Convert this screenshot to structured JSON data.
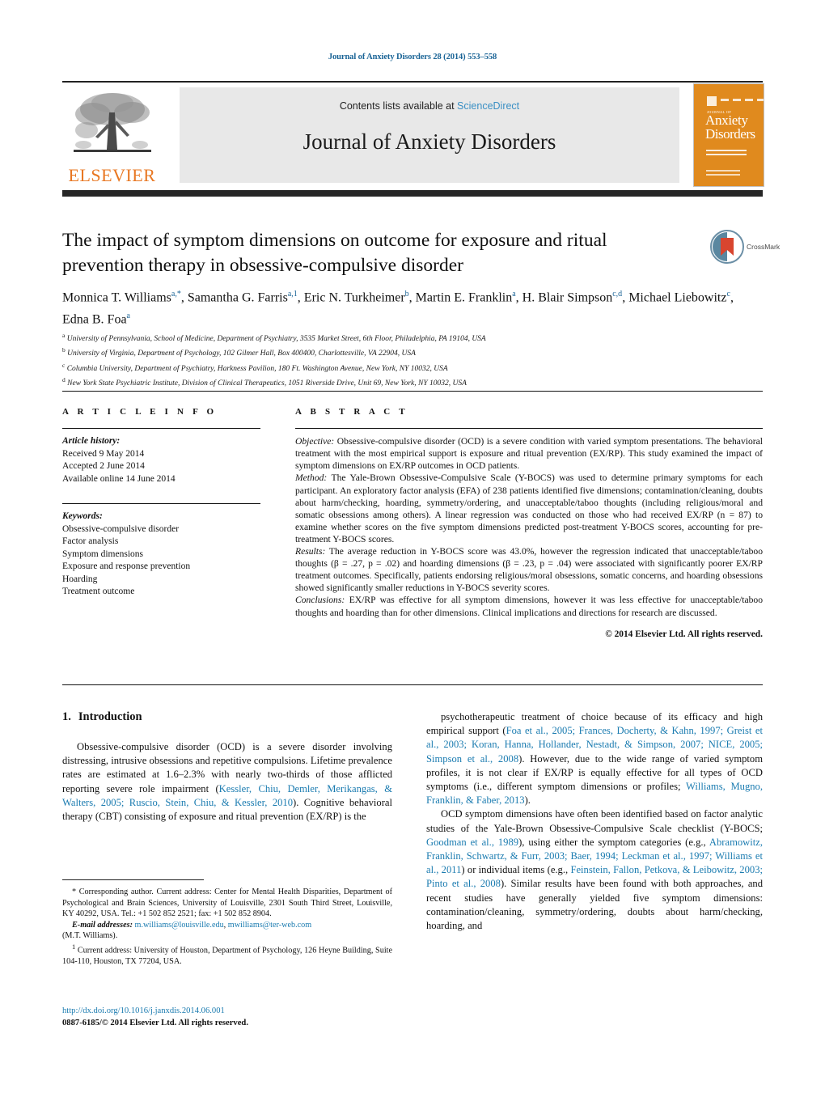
{
  "running_head": "Journal of Anxiety Disorders 28 (2014) 553–558",
  "masthead": {
    "contents_prefix": "Contents lists available at ",
    "sciencedirect": "ScienceDirect",
    "journal_title": "Journal of Anxiety Disorders",
    "publisher_logo_text": "ELSEVIER",
    "cover": {
      "journal_of": "JOURNAL OF",
      "line1": "Anxiety",
      "line2": "Disorders"
    }
  },
  "article": {
    "title": "The impact of symptom dimensions on outcome for exposure and ritual prevention therapy in obsessive-compulsive disorder",
    "crossmark_label": "CrossMark",
    "authors_html": "Monnica T. Williams<sup>a,<span class=\"plain\">*</span></sup>, Samantha G. Farris<sup>a,1</sup>, Eric N. Turkheimer<sup>b</sup>, Martin E. Franklin<sup>a</sup>, H. Blair Simpson<sup>c,d</sup>, Michael Liebowitz<sup>c</sup>, Edna B. Foa<sup>a</sup>",
    "affiliations": [
      {
        "mark": "a",
        "text": "University of Pennsylvania, School of Medicine, Department of Psychiatry, 3535 Market Street, 6th Floor, Philadelphia, PA 19104, USA"
      },
      {
        "mark": "b",
        "text": "University of Virginia, Department of Psychology, 102 Gilmer Hall, Box 400400, Charlottesville, VA 22904, USA"
      },
      {
        "mark": "c",
        "text": "Columbia University, Department of Psychiatry, Harkness Pavilion, 180 Ft. Washington Avenue, New York, NY 10032, USA"
      },
      {
        "mark": "d",
        "text": "New York State Psychiatric Institute, Division of Clinical Therapeutics, 1051 Riverside Drive, Unit 69, New York, NY 10032, USA"
      }
    ]
  },
  "article_info": {
    "heading": "A R T I C L E   I N F O",
    "history_label": "Article history:",
    "history": [
      "Received 9 May 2014",
      "Accepted 2 June 2014",
      "Available online 14 June 2014"
    ],
    "keywords_label": "Keywords:",
    "keywords": [
      "Obsessive-compulsive disorder",
      "Factor analysis",
      "Symptom dimensions",
      "Exposure and response prevention",
      "Hoarding",
      "Treatment outcome"
    ]
  },
  "abstract": {
    "heading": "A B S T R A C T",
    "sections": [
      {
        "label": "Objective:",
        "text": " Obsessive-compulsive disorder (OCD) is a severe condition with varied symptom presentations. The behavioral treatment with the most empirical support is exposure and ritual prevention (EX/RP). This study examined the impact of symptom dimensions on EX/RP outcomes in OCD patients."
      },
      {
        "label": "Method:",
        "text": " The Yale-Brown Obsessive-Compulsive Scale (Y-BOCS) was used to determine primary symptoms for each participant. An exploratory factor analysis (EFA) of 238 patients identified five dimensions; contamination/cleaning, doubts about harm/checking, hoarding, symmetry/ordering, and unacceptable/taboo thoughts (including religious/moral and somatic obsessions among others). A linear regression was conducted on those who had received EX/RP (n = 87) to examine whether scores on the five symptom dimensions predicted post-treatment Y-BOCS scores, accounting for pre-treatment Y-BOCS scores."
      },
      {
        "label": "Results:",
        "text": " The average reduction in Y-BOCS score was 43.0%, however the regression indicated that unacceptable/taboo thoughts (β = .27, p = .02) and hoarding dimensions (β = .23, p = .04) were associated with significantly poorer EX/RP treatment outcomes. Specifically, patients endorsing religious/moral obsessions, somatic concerns, and hoarding obsessions showed significantly smaller reductions in Y-BOCS severity scores."
      },
      {
        "label": "Conclusions:",
        "text": " EX/RP was effective for all symptom dimensions, however it was less effective for unacceptable/taboo thoughts and hoarding than for other dimensions. Clinical implications and directions for research are discussed."
      }
    ],
    "copyright": "© 2014 Elsevier Ltd. All rights reserved."
  },
  "body": {
    "section_number": "1.",
    "section_title": "Introduction",
    "left_paragraph_html": "Obsessive-compulsive disorder (OCD) is a severe disorder involving distressing, intrusive obsessions and repetitive compulsions. Lifetime prevalence rates are estimated at 1.6–2.3% with nearly two-thirds of those afflicted reporting severe role impairment (<span class=\"cite\">Kessler, Chiu, Demler, Merikangas, &amp; Walters, 2005; Ruscio, Stein, Chiu, &amp; Kessler, 2010</span>). Cognitive behavioral therapy (CBT) consisting of exposure and ritual prevention (EX/RP) is the",
    "right_paragraph_1_html": "psychotherapeutic treatment of choice because of its efficacy and high empirical support (<span class=\"cite\">Foa et al., 2005; Frances, Docherty, &amp; Kahn, 1997; Greist et al., 2003; Koran, Hanna, Hollander, Nestadt, &amp; Simpson, 2007; NICE, 2005; Simpson et al., 2008</span>). However, due to the wide range of varied symptom profiles, it is not clear if EX/RP is equally effective for all types of OCD symptoms (i.e., different symptom dimensions or profiles; <span class=\"cite\">Williams, Mugno, Franklin, &amp; Faber, 2013</span>).",
    "right_paragraph_2_html": "OCD symptom dimensions have often been identified based on factor analytic studies of the Yale-Brown Obsessive-Compulsive Scale checklist (Y-BOCS; <span class=\"cite\">Goodman et al., 1989</span>), using either the symptom categories (e.g., <span class=\"cite\">Abramowitz, Franklin, Schwartz, &amp; Furr, 2003; Baer, 1994; Leckman et al., 1997; Williams et al., 2011</span>) or individual items (e.g., <span class=\"cite\">Feinstein, Fallon, Petkova, &amp; Leibowitz, 2003; Pinto et al., 2008</span>). Similar results have been found with both approaches, and recent studies have generally yielded five symptom dimensions: contamination/cleaning, symmetry/ordering, doubts about harm/checking, hoarding, and"
  },
  "footnotes": {
    "corresponding_html": "* Corresponding author. Current address: Center for Mental Health Disparities, Department of Psychological and Brain Sciences, University of Louisville, 2301 South Third Street, Louisville, KY 40292, USA. Tel.: +1 502 852 2521; fax: +1 502 852 8904.",
    "email_label": "E-mail addresses:",
    "email_1": "m.williams@louisville.edu",
    "email_2": "mwilliams@ter-web.com",
    "email_owner": "(M.T. Williams).",
    "current_address_html": "<sup>1</sup> Current address: University of Houston, Department of Psychology, 126 Heyne Building, Suite 104-110, Houston, TX 77204, USA."
  },
  "doi_block": {
    "doi_url": "http://dx.doi.org/10.1016/j.janxdis.2014.06.001",
    "issn_line": "0887-6185/© 2014 Elsevier Ltd. All rights reserved."
  },
  "colors": {
    "link_blue": "#1a7bb0",
    "elsevier_orange": "#E87722",
    "cover_orange": "#E08A1E",
    "rule_dark": "#262626",
    "sd_panel_gray": "#e8e8e8"
  }
}
